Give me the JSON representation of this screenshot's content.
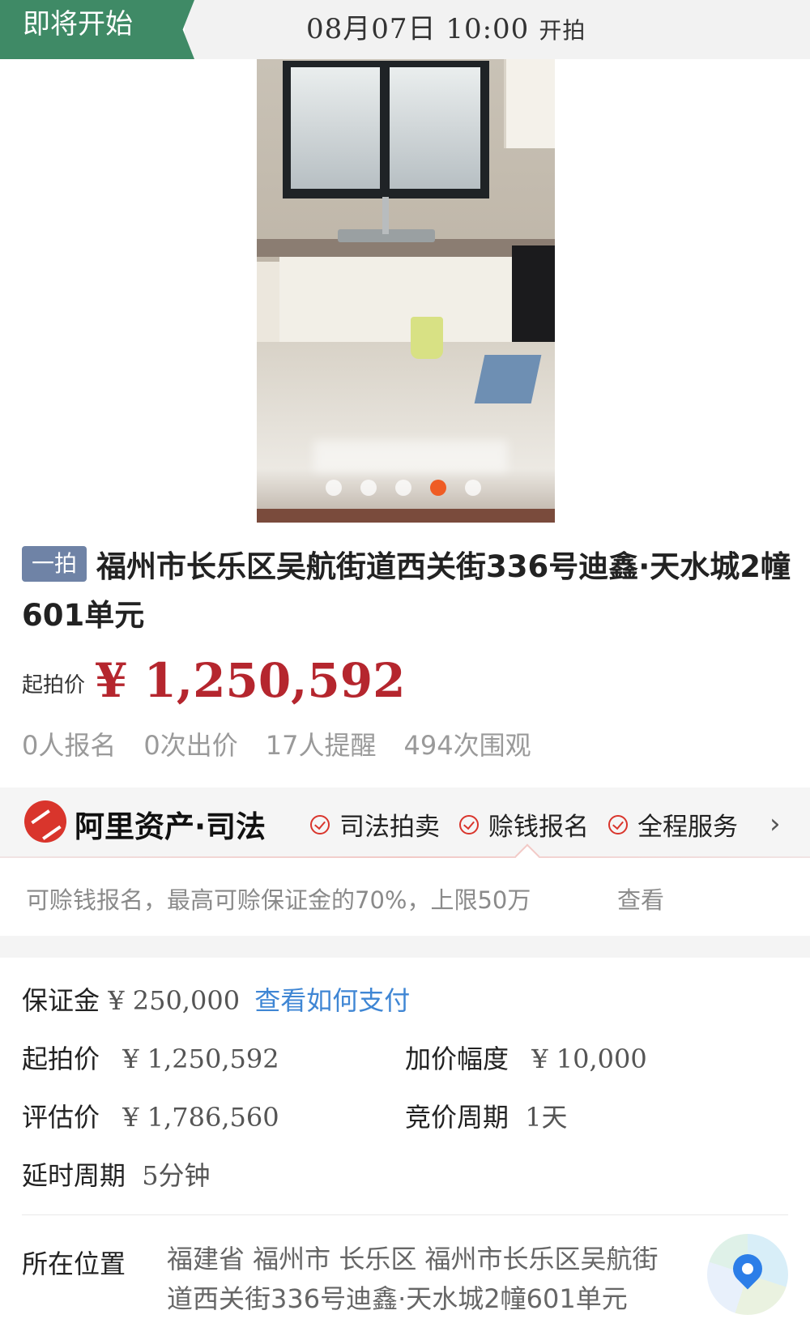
{
  "status": {
    "tag": "即将开始",
    "start_time": "08月07日 10:00",
    "start_suffix": "开拍"
  },
  "gallery": {
    "total_dots": 5,
    "active_index": 3
  },
  "item": {
    "badge": "一拍",
    "title": "福州市长乐区吴航街道西关街336号迪鑫·天水城2幢601单元",
    "price_label": "起拍价",
    "price_value": "¥ 1,250,592",
    "stats": [
      "0人报名",
      "0次出价",
      "17人提醒",
      "494次围观"
    ]
  },
  "service": {
    "brand": "阿里资产·司法",
    "items": [
      "司法拍卖",
      "赊钱报名",
      "全程服务"
    ],
    "note": "可赊钱报名，最高可赊保证金的70%，上限50万",
    "note_link": "查看"
  },
  "details": {
    "deposit_label": "保证金",
    "deposit_value": "¥ 250,000",
    "deposit_link": "查看如何支付",
    "start_label": "起拍价",
    "start_value": "¥ 1,250,592",
    "increment_label": "加价幅度",
    "increment_value": "¥ 10,000",
    "appraisal_label": "评估价",
    "appraisal_value": "¥ 1,786,560",
    "cycle_label": "竞价周期",
    "cycle_value": "1天",
    "delay_label": "延时周期",
    "delay_value": "5分钟",
    "location_label": "所在位置",
    "location_value": "福建省 福州市 长乐区 福州市长乐区吴航街道西关街336号迪鑫·天水城2幢601单元"
  },
  "colors": {
    "accent_green": "#3f8a66",
    "price_red": "#b5262e",
    "link_blue": "#3f86d4",
    "dot_active": "#ef5c24"
  },
  "icons": [
    "check-circle-icon",
    "chevron-right-icon",
    "map-pin-icon",
    "ali-asset-logo-icon"
  ]
}
